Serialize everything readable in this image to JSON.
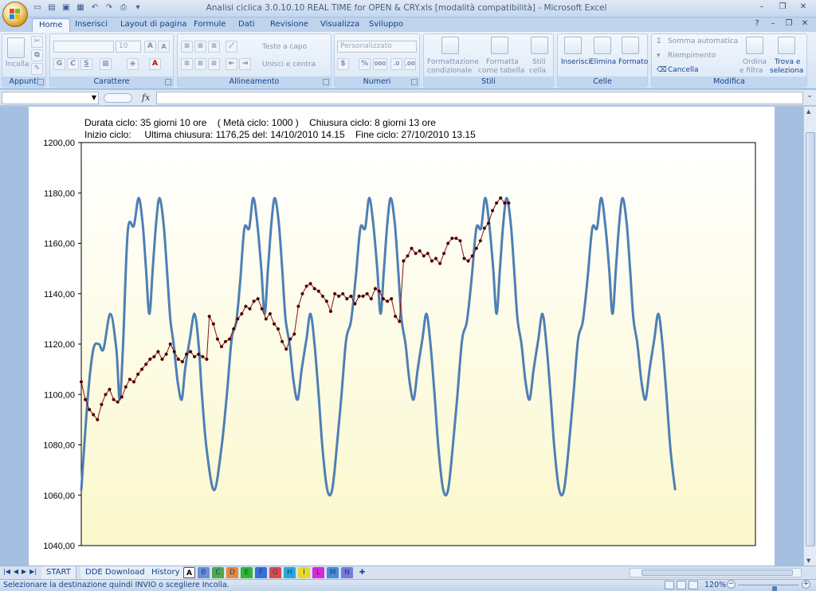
{
  "window": {
    "title": "Analisi ciclica 3.0.10.10 REAL TIME for OPEN & CRY.xls  [modalità compatibilità]  - Microsoft Excel",
    "minimize": "–",
    "restore": "❐",
    "close": "✕"
  },
  "tabs": [
    "Home",
    "Inserisci",
    "Layout di pagina",
    "Formule",
    "Dati",
    "Revisione",
    "Visualizza",
    "Sviluppo"
  ],
  "active_tab": "Home",
  "ribbon": {
    "appunti": {
      "label": "Appunti",
      "incolla": "Incolla"
    },
    "carattere": {
      "label": "Carattere",
      "font_size": "10",
      "grow": "A",
      "shrink": "A",
      "bold": "G",
      "italic": "C",
      "underline": "S"
    },
    "allineamento": {
      "label": "Allineamento",
      "wrap": "Testo a capo",
      "merge": "Unisci e centra"
    },
    "numeri": {
      "label": "Numeri",
      "format": "Personalizzato",
      "percent": "%",
      "thousands": "000"
    },
    "stili": {
      "label": "Stili",
      "cond1": "Formattazione",
      "cond2": "condizionale",
      "table1": "Formatta",
      "table2": "come tabella",
      "cell1": "Stili",
      "cell2": "cella"
    },
    "celle": {
      "label": "Celle",
      "insert": "Inserisci",
      "delete": "Elimina",
      "format": "Formato"
    },
    "modifica": {
      "label": "Modifica",
      "autosum": "Somma automatica",
      "fill": "Riempimento",
      "clear": "Cancella",
      "sort1": "Ordina",
      "sort2": "e filtra",
      "find1": "Trova e",
      "find2": "seleziona"
    }
  },
  "formula_bar": {
    "fx": "fx",
    "name_box": "",
    "formula": ""
  },
  "chart_header": {
    "line1": "Durata ciclo: 35 giorni 10 ore    ( Metà ciclo: 1000 )    Chiusura ciclo: 8 giorni 13 ore",
    "line2": "Inizio ciclo:     Ultima chiusura: 1176,25 del: 14/10/2010 14.15    Fine ciclo: 27/10/2010 13.15"
  },
  "chart_data": {
    "type": "line",
    "ylim": [
      1040,
      1200
    ],
    "ytick_labels": [
      "1200,00",
      "1180,00",
      "1160,00",
      "1140,00",
      "1120,00",
      "1100,00",
      "1080,00",
      "1060,00",
      "1040,00"
    ],
    "colors": {
      "cycle": "#4e7fb5",
      "price": "#8b0f0f",
      "background_top": "#ffffff",
      "background_bottom": "#fbf8cc"
    },
    "x_range": [
      0,
      1000
    ],
    "series": [
      {
        "style": "smooth-line",
        "points": [
          [
            0,
            1062
          ],
          [
            10,
            1100
          ],
          [
            18,
            1118
          ],
          [
            26,
            1120
          ],
          [
            33,
            1118
          ],
          [
            43,
            1132
          ],
          [
            52,
            1118
          ],
          [
            57,
            1098
          ],
          [
            62,
            1120
          ],
          [
            69,
            1165
          ],
          [
            78,
            1167
          ],
          [
            85,
            1178
          ],
          [
            91,
            1168
          ],
          [
            96,
            1150
          ],
          [
            101,
            1132
          ],
          [
            106,
            1150
          ],
          [
            111,
            1168
          ],
          [
            116,
            1178
          ],
          [
            122,
            1168
          ],
          [
            127,
            1150
          ],
          [
            132,
            1130
          ],
          [
            137,
            1120
          ],
          [
            143,
            1105
          ],
          [
            149,
            1098
          ],
          [
            154,
            1110
          ],
          [
            161,
            1122
          ],
          [
            168,
            1132
          ],
          [
            174,
            1120
          ],
          [
            179,
            1100
          ],
          [
            186,
            1078
          ],
          [
            197,
            1062
          ],
          [
            208,
            1079
          ],
          [
            216,
            1100
          ],
          [
            223,
            1122
          ],
          [
            230,
            1129
          ],
          [
            236,
            1146
          ],
          [
            242,
            1166
          ],
          [
            249,
            1166
          ],
          [
            255,
            1178
          ],
          [
            261,
            1168
          ],
          [
            267,
            1150
          ],
          [
            272,
            1132
          ],
          [
            277,
            1150
          ],
          [
            282,
            1168
          ],
          [
            287,
            1178
          ],
          [
            293,
            1168
          ],
          [
            298,
            1150
          ],
          [
            303,
            1130
          ],
          [
            309,
            1120
          ],
          [
            315,
            1105
          ],
          [
            321,
            1098
          ],
          [
            327,
            1110
          ],
          [
            334,
            1122
          ],
          [
            340,
            1132
          ],
          [
            346,
            1120
          ],
          [
            352,
            1100
          ],
          [
            358,
            1078
          ],
          [
            365,
            1062
          ],
          [
            372,
            1062
          ],
          [
            379,
            1079
          ],
          [
            386,
            1100
          ],
          [
            393,
            1122
          ],
          [
            400,
            1129
          ],
          [
            407,
            1146
          ],
          [
            414,
            1166
          ],
          [
            421,
            1166
          ],
          [
            427,
            1178
          ],
          [
            433,
            1168
          ],
          [
            439,
            1150
          ],
          [
            444,
            1132
          ],
          [
            449,
            1150
          ],
          [
            454,
            1168
          ],
          [
            459,
            1178
          ],
          [
            465,
            1168
          ],
          [
            470,
            1150
          ],
          [
            475,
            1130
          ],
          [
            481,
            1120
          ],
          [
            487,
            1105
          ],
          [
            493,
            1098
          ],
          [
            499,
            1110
          ],
          [
            506,
            1122
          ],
          [
            512,
            1132
          ],
          [
            518,
            1120
          ],
          [
            524,
            1100
          ],
          [
            530,
            1078
          ],
          [
            537,
            1062
          ],
          [
            544,
            1062
          ],
          [
            551,
            1079
          ],
          [
            558,
            1100
          ],
          [
            565,
            1122
          ],
          [
            572,
            1129
          ],
          [
            579,
            1146
          ],
          [
            586,
            1166
          ],
          [
            593,
            1166
          ],
          [
            599,
            1178
          ],
          [
            605,
            1168
          ],
          [
            611,
            1150
          ],
          [
            616,
            1132
          ],
          [
            621,
            1150
          ],
          [
            626,
            1168
          ],
          [
            631,
            1178
          ],
          [
            637,
            1168
          ],
          [
            642,
            1150
          ],
          [
            647,
            1130
          ],
          [
            653,
            1120
          ],
          [
            659,
            1105
          ],
          [
            665,
            1098
          ],
          [
            671,
            1110
          ],
          [
            678,
            1122
          ],
          [
            684,
            1132
          ],
          [
            690,
            1120
          ],
          [
            696,
            1100
          ],
          [
            702,
            1078
          ],
          [
            709,
            1062
          ],
          [
            716,
            1062
          ],
          [
            723,
            1079
          ],
          [
            730,
            1100
          ],
          [
            737,
            1122
          ],
          [
            744,
            1129
          ],
          [
            751,
            1146
          ],
          [
            758,
            1166
          ],
          [
            765,
            1166
          ],
          [
            771,
            1178
          ],
          [
            777,
            1168
          ],
          [
            783,
            1150
          ],
          [
            788,
            1132
          ],
          [
            793,
            1150
          ],
          [
            798,
            1168
          ],
          [
            803,
            1178
          ],
          [
            809,
            1168
          ],
          [
            814,
            1150
          ],
          [
            819,
            1130
          ],
          [
            825,
            1120
          ],
          [
            831,
            1105
          ],
          [
            837,
            1098
          ],
          [
            843,
            1110
          ],
          [
            850,
            1122
          ],
          [
            856,
            1132
          ],
          [
            862,
            1120
          ],
          [
            868,
            1100
          ],
          [
            874,
            1078
          ],
          [
            881,
            1062
          ]
        ]
      },
      {
        "style": "markers-line",
        "points": [
          [
            0,
            1105
          ],
          [
            6,
            1098
          ],
          [
            12,
            1094
          ],
          [
            18,
            1092
          ],
          [
            24,
            1090
          ],
          [
            30,
            1096
          ],
          [
            36,
            1100
          ],
          [
            42,
            1102
          ],
          [
            48,
            1098
          ],
          [
            54,
            1097
          ],
          [
            60,
            1099
          ],
          [
            66,
            1103
          ],
          [
            72,
            1106
          ],
          [
            78,
            1105
          ],
          [
            84,
            1108
          ],
          [
            90,
            1110
          ],
          [
            96,
            1112
          ],
          [
            102,
            1114
          ],
          [
            108,
            1115
          ],
          [
            114,
            1117
          ],
          [
            120,
            1114
          ],
          [
            126,
            1116
          ],
          [
            132,
            1120
          ],
          [
            138,
            1117
          ],
          [
            144,
            1114
          ],
          [
            150,
            1113
          ],
          [
            156,
            1116
          ],
          [
            162,
            1117
          ],
          [
            168,
            1115
          ],
          [
            174,
            1116
          ],
          [
            180,
            1115
          ],
          [
            186,
            1114
          ],
          [
            190,
            1131
          ],
          [
            196,
            1128
          ],
          [
            202,
            1122
          ],
          [
            208,
            1119
          ],
          [
            214,
            1121
          ],
          [
            220,
            1122
          ],
          [
            226,
            1126
          ],
          [
            232,
            1130
          ],
          [
            238,
            1132
          ],
          [
            244,
            1135
          ],
          [
            250,
            1134
          ],
          [
            256,
            1137
          ],
          [
            262,
            1138
          ],
          [
            268,
            1134
          ],
          [
            274,
            1130
          ],
          [
            280,
            1132
          ],
          [
            286,
            1128
          ],
          [
            292,
            1126
          ],
          [
            298,
            1121
          ],
          [
            304,
            1118
          ],
          [
            310,
            1122
          ],
          [
            316,
            1124
          ],
          [
            322,
            1135
          ],
          [
            328,
            1140
          ],
          [
            334,
            1143
          ],
          [
            340,
            1144
          ],
          [
            346,
            1142
          ],
          [
            352,
            1141
          ],
          [
            358,
            1139
          ],
          [
            364,
            1137
          ],
          [
            370,
            1133
          ],
          [
            376,
            1140
          ],
          [
            382,
            1139
          ],
          [
            388,
            1140
          ],
          [
            394,
            1138
          ],
          [
            400,
            1139
          ],
          [
            406,
            1136
          ],
          [
            412,
            1139
          ],
          [
            418,
            1139
          ],
          [
            424,
            1140
          ],
          [
            430,
            1138
          ],
          [
            436,
            1142
          ],
          [
            442,
            1141
          ],
          [
            448,
            1138
          ],
          [
            454,
            1137
          ],
          [
            460,
            1138
          ],
          [
            466,
            1131
          ],
          [
            472,
            1129
          ],
          [
            478,
            1153
          ],
          [
            484,
            1155
          ],
          [
            490,
            1158
          ],
          [
            496,
            1156
          ],
          [
            502,
            1157
          ],
          [
            508,
            1155
          ],
          [
            514,
            1156
          ],
          [
            520,
            1153
          ],
          [
            526,
            1154
          ],
          [
            532,
            1152
          ],
          [
            538,
            1156
          ],
          [
            544,
            1160
          ],
          [
            550,
            1162
          ],
          [
            556,
            1162
          ],
          [
            562,
            1161
          ],
          [
            568,
            1154
          ],
          [
            574,
            1153
          ],
          [
            580,
            1155
          ],
          [
            586,
            1158
          ],
          [
            592,
            1161
          ],
          [
            598,
            1166
          ],
          [
            604,
            1168
          ],
          [
            610,
            1173
          ],
          [
            616,
            1176
          ],
          [
            622,
            1178
          ],
          [
            628,
            1176
          ],
          [
            634,
            1176
          ]
        ]
      }
    ]
  },
  "sheet_tabs": [
    "START",
    "DDE Download",
    "History"
  ],
  "color_tabs": [
    "A",
    "B",
    "C",
    "D",
    "E",
    "F",
    "G",
    "H",
    "I",
    "L",
    "M",
    "N"
  ],
  "active_color_tab": "A",
  "status": {
    "text": "Selezionare la destinazione quindi INVIO o scegliere Incolla.",
    "zoom": "120%",
    "zoom_level_pct": 60
  }
}
